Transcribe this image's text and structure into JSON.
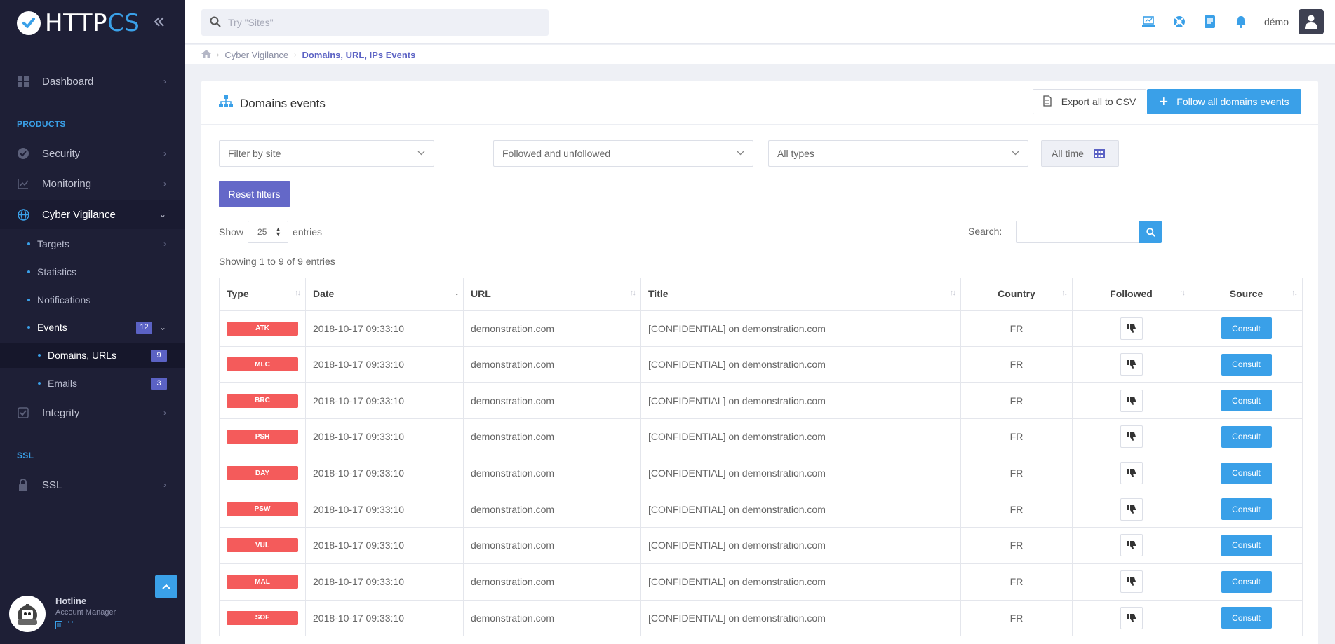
{
  "app": {
    "logo_part1": "HTTP",
    "logo_part2": "CS",
    "brand_color": "#3aa0e8",
    "accent_color": "#5b62c4",
    "danger_color": "#f45b5b"
  },
  "sidebar": {
    "dashboard": "Dashboard",
    "section_products": "PRODUCTS",
    "security": "Security",
    "monitoring": "Monitoring",
    "cyber_vigilance": "Cyber Vigilance",
    "targets": "Targets",
    "statistics": "Statistics",
    "notifications": "Notifications",
    "events": "Events",
    "events_count": "12",
    "domains_urls": "Domains, URLs",
    "domains_urls_count": "9",
    "emails": "Emails",
    "emails_count": "3",
    "integrity": "Integrity",
    "section_ssl": "SSL",
    "ssl": "SSL",
    "hotline_title": "Hotline",
    "hotline_sub": "Account Manager"
  },
  "topbar": {
    "search_placeholder": "Try \"Sites\"",
    "user_name": "démo"
  },
  "breadcrumb": {
    "level1": "Cyber Vigilance",
    "current": "Domains, URL, IPs Events"
  },
  "card": {
    "title": "Domains events",
    "export_label": "Export all to CSV",
    "follow_label": "Follow all domains events",
    "filter_site": "Filter by site",
    "filter_follow": "Followed and unfollowed",
    "filter_types": "All types",
    "filter_time": "All time",
    "reset_label": "Reset filters",
    "show_label": "Show",
    "show_value": "25",
    "entries_label": "entries",
    "search_label": "Search:",
    "showing_text": "Showing 1 to 9 of 9 entries"
  },
  "table": {
    "headers": {
      "type": "Type",
      "date": "Date",
      "url": "URL",
      "title": "Title",
      "country": "Country",
      "followed": "Followed",
      "source": "Source"
    },
    "consult_label": "Consult",
    "rows": [
      {
        "type": "ATK",
        "date": "2018-10-17 09:33:10",
        "url": "demonstration.com",
        "title": "[CONFIDENTIAL] on demonstration.com",
        "country": "FR"
      },
      {
        "type": "MLC",
        "date": "2018-10-17 09:33:10",
        "url": "demonstration.com",
        "title": "[CONFIDENTIAL] on demonstration.com",
        "country": "FR"
      },
      {
        "type": "BRC",
        "date": "2018-10-17 09:33:10",
        "url": "demonstration.com",
        "title": "[CONFIDENTIAL] on demonstration.com",
        "country": "FR"
      },
      {
        "type": "PSH",
        "date": "2018-10-17 09:33:10",
        "url": "demonstration.com",
        "title": "[CONFIDENTIAL] on demonstration.com",
        "country": "FR"
      },
      {
        "type": "DAY",
        "date": "2018-10-17 09:33:10",
        "url": "demonstration.com",
        "title": "[CONFIDENTIAL] on demonstration.com",
        "country": "FR"
      },
      {
        "type": "PSW",
        "date": "2018-10-17 09:33:10",
        "url": "demonstration.com",
        "title": "[CONFIDENTIAL] on demonstration.com",
        "country": "FR"
      },
      {
        "type": "VUL",
        "date": "2018-10-17 09:33:10",
        "url": "demonstration.com",
        "title": "[CONFIDENTIAL] on demonstration.com",
        "country": "FR"
      },
      {
        "type": "MAL",
        "date": "2018-10-17 09:33:10",
        "url": "demonstration.com",
        "title": "[CONFIDENTIAL] on demonstration.com",
        "country": "FR"
      },
      {
        "type": "SOF",
        "date": "2018-10-17 09:33:10",
        "url": "demonstration.com",
        "title": "[CONFIDENTIAL] on demonstration.com",
        "country": "FR"
      }
    ]
  }
}
